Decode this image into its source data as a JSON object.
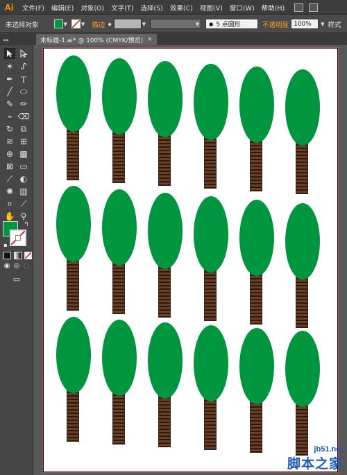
{
  "app": {
    "logo": "Ai"
  },
  "menu": {
    "items": [
      "文件(F)",
      "编辑(E)",
      "对象(O)",
      "文字(T)",
      "选择(S)",
      "效果(C)",
      "视图(V)",
      "窗口(W)",
      "帮助(H)"
    ]
  },
  "control_bar": {
    "selection_status": "未选择对象",
    "fill_color": "#00963f",
    "stroke_label": "描边",
    "brush_label": "5 点圆形",
    "opacity_label": "不透明度",
    "opacity_value": "100%",
    "style_label": "样式"
  },
  "document": {
    "tab_title": "未标题-1.ai* @ 100% (CMYK/预览)",
    "close_glyph": "×"
  },
  "artwork": {
    "crown_color": "#00963f",
    "trunk_color": "#6a4126",
    "rows": 3,
    "columns": 6
  },
  "watermark": {
    "site": "jb51.net",
    "name": "脚本之家"
  }
}
